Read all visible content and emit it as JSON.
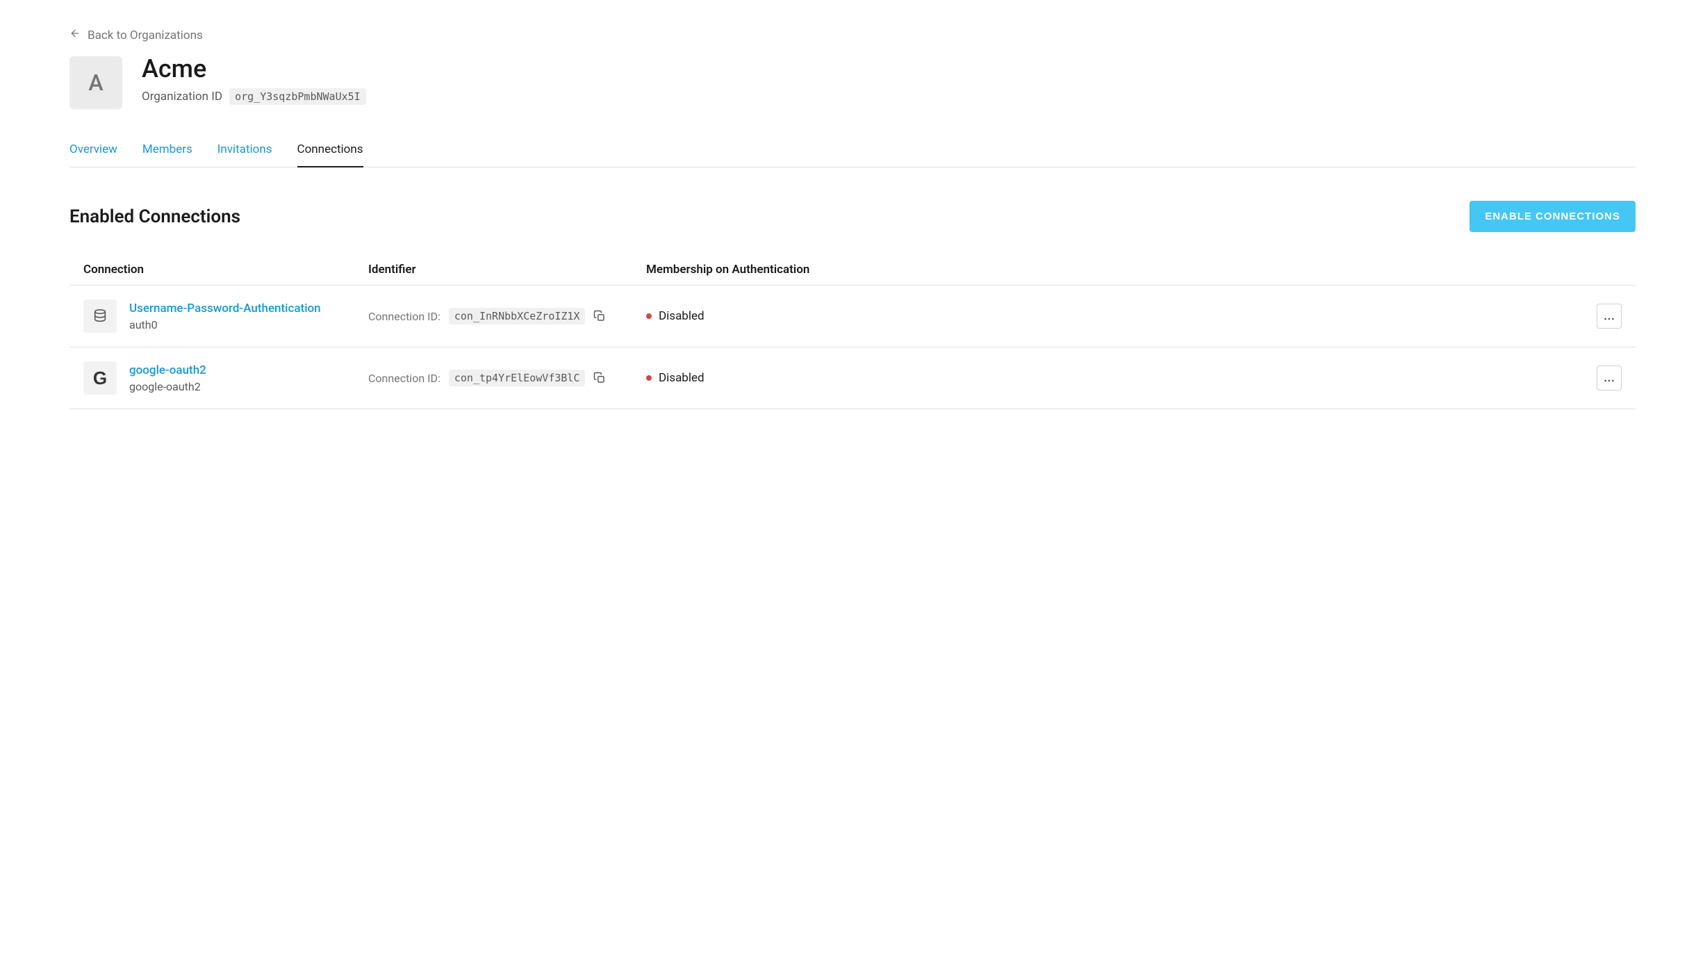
{
  "back_link": {
    "label": "Back to Organizations"
  },
  "org": {
    "avatar_letter": "A",
    "name": "Acme",
    "id_label": "Organization ID",
    "id_value": "org_Y3sqzbPmbNWaUx5I"
  },
  "tabs": [
    {
      "label": "Overview",
      "active": false
    },
    {
      "label": "Members",
      "active": false
    },
    {
      "label": "Invitations",
      "active": false
    },
    {
      "label": "Connections",
      "active": true
    }
  ],
  "section": {
    "title": "Enabled Connections",
    "enable_button": "ENABLE CONNECTIONS"
  },
  "table": {
    "headers": {
      "connection": "Connection",
      "identifier": "Identifier",
      "membership": "Membership on Authentication"
    },
    "identifier_label": "Connection ID:",
    "rows": [
      {
        "icon": "database",
        "name": "Username-Password-Authentication",
        "strategy": "auth0",
        "connection_id": "con_InRNbbXCeZroIZ1X",
        "membership_status": "Disabled",
        "status_color": "red"
      },
      {
        "icon": "google",
        "name": "google-oauth2",
        "strategy": "google-oauth2",
        "connection_id": "con_tp4YrElEowVf3BlC",
        "membership_status": "Disabled",
        "status_color": "red"
      }
    ]
  }
}
